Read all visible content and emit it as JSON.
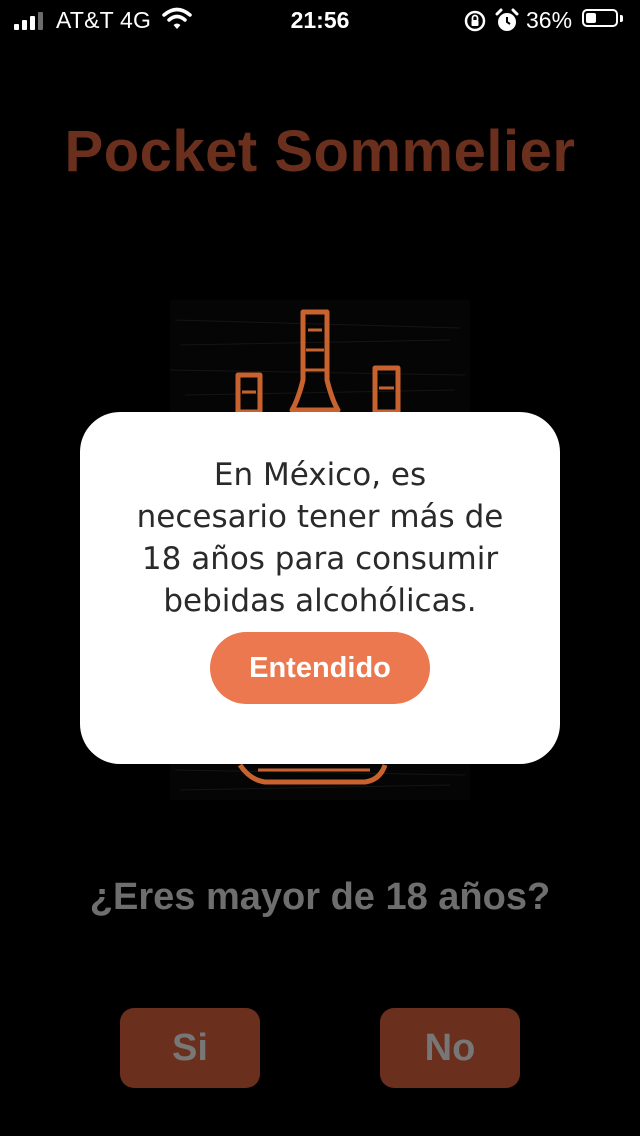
{
  "status_bar": {
    "carrier": "AT&T 4G",
    "time": "21:56",
    "battery_percent": "36%",
    "battery_level": 0.36,
    "signal_bars": 4,
    "signal_bars_filled": 3,
    "icons": [
      "signal-icon",
      "wifi-icon",
      "rotation-lock-icon",
      "alarm-icon",
      "battery-icon"
    ]
  },
  "app": {
    "title": "Pocket Sommelier",
    "title_color": "#6b2f1e",
    "illustration": "wine-bottles-illustration"
  },
  "age_check": {
    "question": "¿Eres mayor de 18 años?",
    "yes_label": "Si",
    "no_label": "No",
    "button_color": "#6b2f1e"
  },
  "modal": {
    "line1": "En México, es",
    "line2": "necesario tener más de",
    "line3": "18 años para consumir",
    "line4": "bebidas alcohólicas.",
    "button_label": "Entendido",
    "button_color": "#ec7850"
  }
}
